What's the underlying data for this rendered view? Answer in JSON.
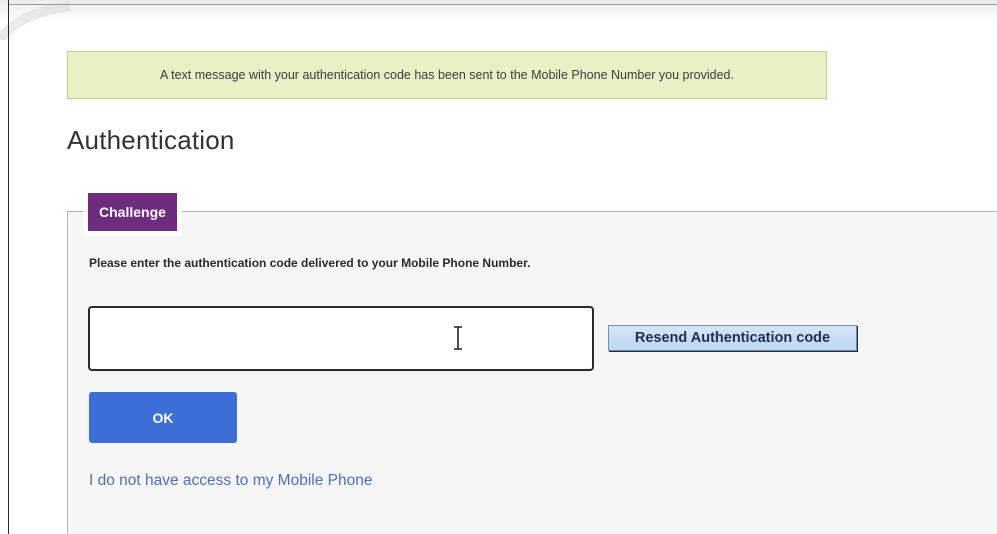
{
  "notice": {
    "message": "A text message with your authentication code has been sent to the Mobile Phone Number you provided."
  },
  "page": {
    "title": "Authentication"
  },
  "challenge": {
    "legend": "Challenge",
    "instruction": "Please enter the authentication code delivered to your Mobile Phone Number.",
    "code_input": {
      "value": "",
      "placeholder": ""
    },
    "resend_label": "Resend Authentication code",
    "ok_label": "OK",
    "no_access_link": "I do not have access to my Mobile Phone"
  },
  "icons": {
    "cursor": "text-cursor-icon"
  },
  "colors": {
    "legend_bg": "#6e2c7f",
    "ok_button_bg": "#3d6fd6",
    "link": "#4f6fbf",
    "notice_bg": "#eaf0c6",
    "resend_bg": "#c9ddf4"
  }
}
